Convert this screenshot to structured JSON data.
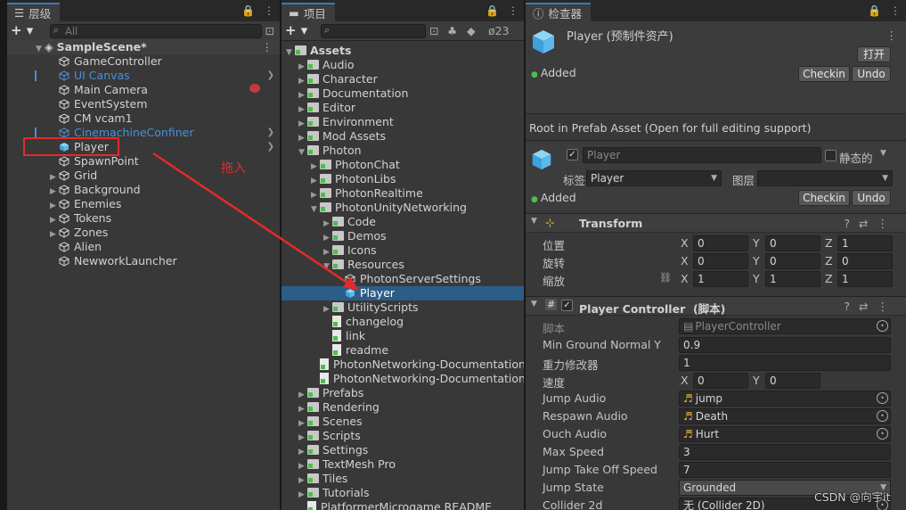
{
  "hierarchy": {
    "tab": "层级",
    "search": "All",
    "scene": "SampleScene*",
    "items": [
      "GameController",
      "UI Canvas",
      "Main Camera",
      "EventSystem",
      "CM vcam1",
      "CinemachineConfiner",
      "Player",
      "SpawnPoint",
      "Grid",
      "Background",
      "Enemies",
      "Tokens",
      "Zones",
      "Alien",
      "NewworkLauncher"
    ]
  },
  "project": {
    "tab": "项目",
    "search": "",
    "hidden_count": "23",
    "items": [
      "Assets",
      "Audio",
      "Character",
      "Documentation",
      "Editor",
      "Environment",
      "Mod Assets",
      "Photon",
      "PhotonChat",
      "PhotonLibs",
      "PhotonRealtime",
      "PhotonUnityNetworking",
      "Code",
      "Demos",
      "Icons",
      "Resources",
      "PhotonServerSettings",
      "Player",
      "UtilityScripts",
      "changelog",
      "link",
      "readme",
      "PhotonNetworking-Documentation",
      "PhotonNetworking-Documentation",
      "Prefabs",
      "Rendering",
      "Scenes",
      "Scripts",
      "Settings",
      "TextMesh Pro",
      "Tiles",
      "Tutorials",
      "PlatformerMicrogame README"
    ]
  },
  "annotation": "拖入",
  "inspector": {
    "tab": "检查器",
    "title": "Player (预制件资产)",
    "open": "打开",
    "added": "Added",
    "checkin": "Checkin",
    "undo": "Undo",
    "root_msg": "Root in Prefab Asset (Open for full editing support)",
    "name": "Player",
    "static": "静态的",
    "tag_label": "标签",
    "tag": "Player",
    "layer_label": "图层",
    "layer": "",
    "transform": {
      "title": "Transform",
      "pos": "位置",
      "rot": "旋转",
      "scale": "缩放",
      "x": "X",
      "y": "Y",
      "z": "Z",
      "p": [
        "0",
        "0",
        "1"
      ],
      "r": [
        "0",
        "0",
        "0"
      ],
      "s": [
        "1",
        "1",
        "1"
      ]
    },
    "pc": {
      "title": "Player Controller",
      "suffix": "(脚本)",
      "script_label": "脚本",
      "script": "PlayerController",
      "rows": [
        {
          "label": "Min Ground Normal Y",
          "value": "0.9"
        },
        {
          "label": "重力修改器",
          "value": "1"
        },
        {
          "label": "速度",
          "x": "0",
          "y": "0"
        },
        {
          "label": "Jump Audio",
          "value": "jump"
        },
        {
          "label": "Respawn Audio",
          "value": "Death"
        },
        {
          "label": "Ouch Audio",
          "value": "Hurt"
        },
        {
          "label": "Max Speed",
          "value": "3"
        },
        {
          "label": "Jump Take Off Speed",
          "value": "7"
        },
        {
          "label": "Jump State",
          "value": "Grounded"
        },
        {
          "label": "Collider 2d",
          "value": "无 (Collider 2D)"
        }
      ]
    }
  },
  "watermark": "CSDN @向宇it"
}
